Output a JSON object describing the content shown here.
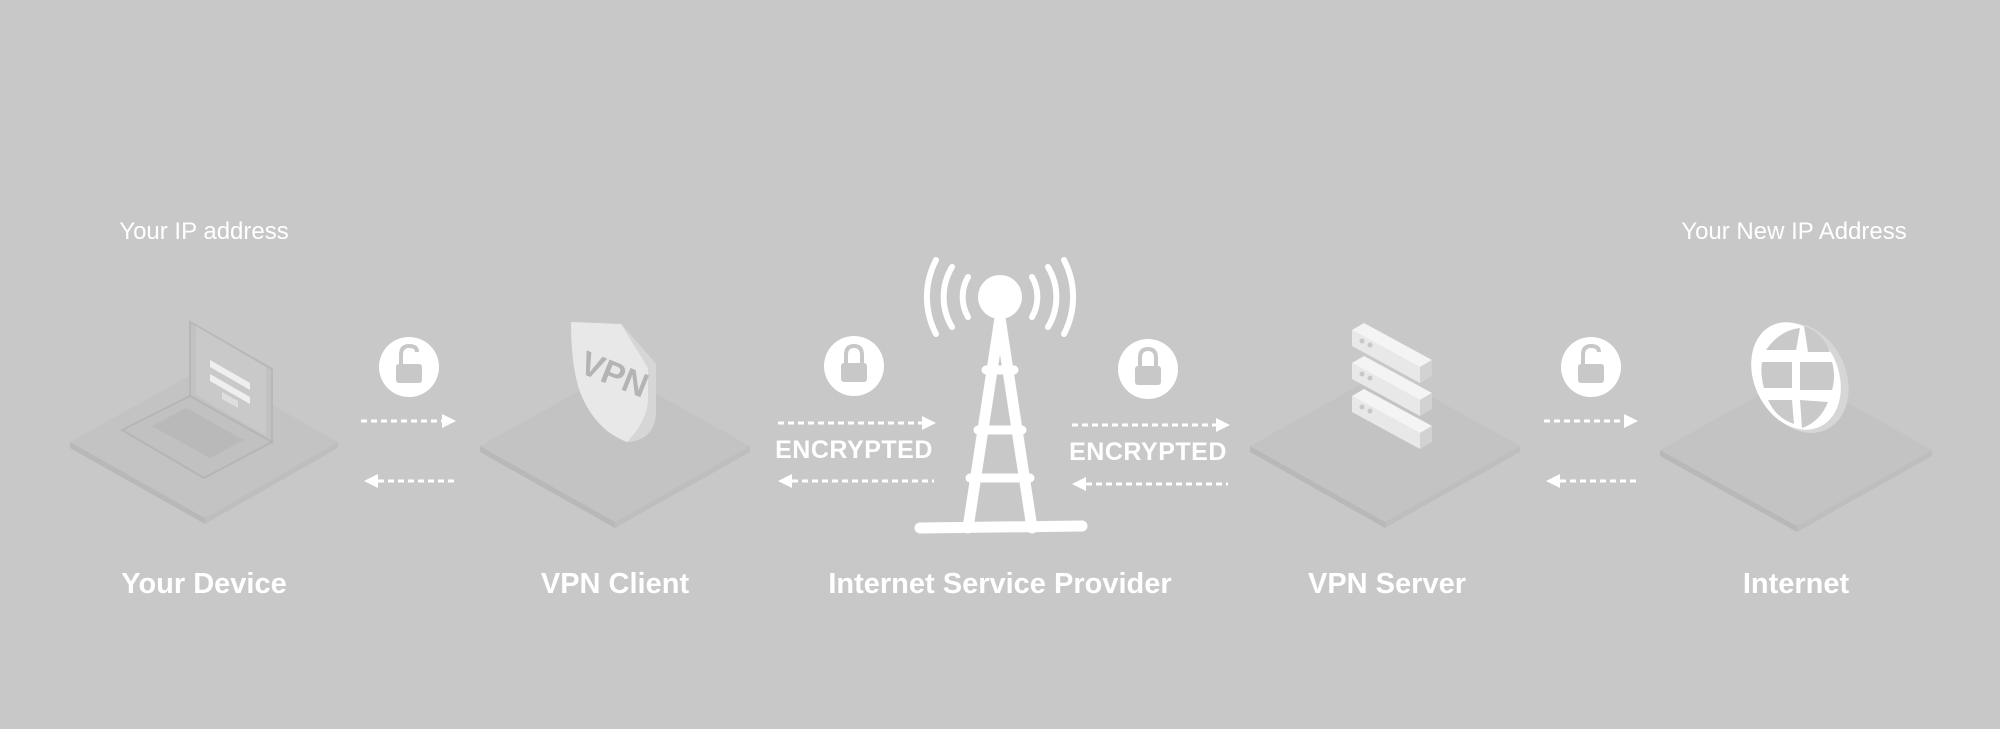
{
  "ip_labels": {
    "start": "Your IP address",
    "end": "Your New IP Address"
  },
  "nodes": [
    {
      "id": "device",
      "label": "Your Device",
      "icon": "laptop-icon"
    },
    {
      "id": "vpn-client",
      "label": "VPN Client",
      "icon": "shield-icon",
      "icon_text": "VPN"
    },
    {
      "id": "isp",
      "label": "Internet Service Provider",
      "icon": "radio-tower-icon"
    },
    {
      "id": "vpn-server",
      "label": "VPN Server",
      "icon": "server-icon"
    },
    {
      "id": "internet",
      "label": "Internet",
      "icon": "globe-icon"
    }
  ],
  "links": [
    {
      "from": "device",
      "to": "vpn-client",
      "lock": "unlocked",
      "label": ""
    },
    {
      "from": "vpn-client",
      "to": "isp",
      "lock": "locked",
      "label": "ENCRYPTED"
    },
    {
      "from": "isp",
      "to": "vpn-server",
      "lock": "locked",
      "label": "ENCRYPTED"
    },
    {
      "from": "vpn-server",
      "to": "internet",
      "lock": "unlocked",
      "label": ""
    }
  ],
  "colors": {
    "background": "#c8c8c8",
    "platform_top": "#c3c3c3",
    "platform_left": "#b9b9b9",
    "platform_right": "#bdbdbd",
    "foreground": "#ffffff"
  }
}
